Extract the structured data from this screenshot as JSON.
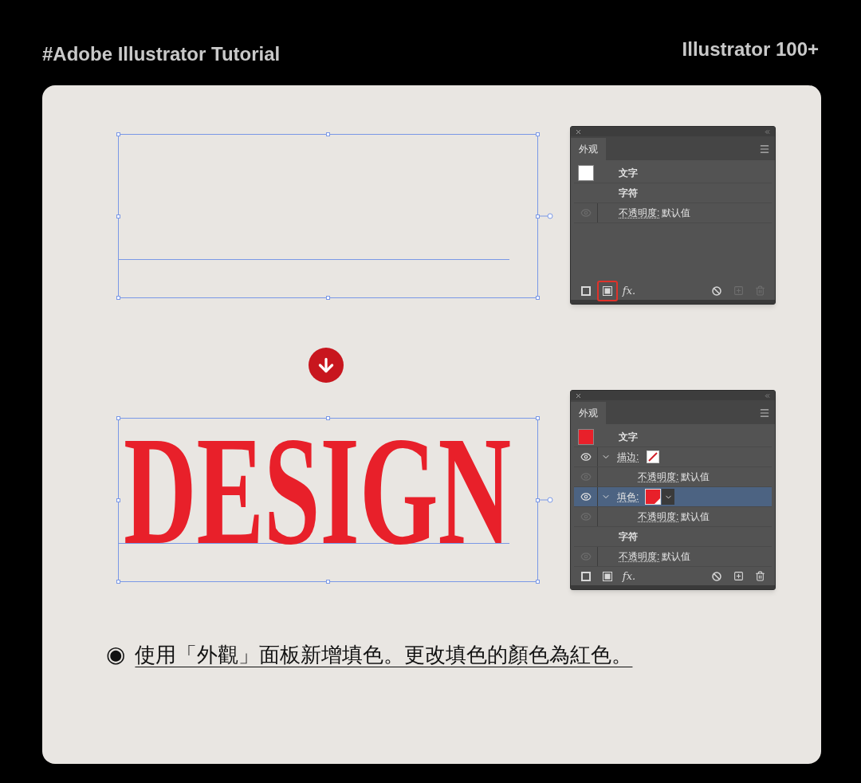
{
  "header": {
    "hashtag": "#Adobe Illustrator Tutorial",
    "series": "Illustrator 100+"
  },
  "steps": [
    {
      "panel": {
        "tab": "外观",
        "rows": [
          {
            "kind": "object",
            "label": "文字",
            "color": "#ffffff",
            "selected": false
          },
          {
            "kind": "group",
            "label": "字符",
            "selected": false
          },
          {
            "kind": "opacity",
            "label": "不透明度:",
            "value": "默认值",
            "eye_on": false,
            "selected": false
          }
        ],
        "footer": [
          {
            "kind": "new-stroke",
            "highlighted": false,
            "disabled": false
          },
          {
            "kind": "new-fill",
            "highlighted": true,
            "disabled": false
          },
          {
            "kind": "fx",
            "label": "fx.",
            "highlighted": false,
            "disabled": false
          },
          {
            "kind": "clear",
            "highlighted": false,
            "disabled": false
          },
          {
            "kind": "duplicate",
            "highlighted": false,
            "disabled": true
          },
          {
            "kind": "delete",
            "highlighted": false,
            "disabled": true
          }
        ]
      }
    },
    {
      "artwork_text": "DESIGN",
      "panel": {
        "tab": "外观",
        "rows": [
          {
            "kind": "object",
            "label": "文字",
            "color": "#e8202a",
            "selected": false
          },
          {
            "kind": "stroke",
            "label": "描边:",
            "eye_on": true,
            "expanded": true,
            "selected": false,
            "children": [
              {
                "kind": "opacity",
                "label": "不透明度:",
                "value": "默认值",
                "eye_on": false,
                "selected": false
              }
            ]
          },
          {
            "kind": "fill",
            "label": "填色:",
            "color": "#e8202a",
            "eye_on": true,
            "expanded": true,
            "selected": true,
            "children": [
              {
                "kind": "opacity",
                "label": "不透明度:",
                "value": "默认值",
                "eye_on": false,
                "selected": false
              }
            ]
          },
          {
            "kind": "group",
            "label": "字符",
            "selected": false
          },
          {
            "kind": "opacity",
            "label": "不透明度:",
            "value": "默认值",
            "eye_on": false,
            "selected": false
          }
        ],
        "footer": [
          {
            "kind": "new-stroke",
            "highlighted": false,
            "disabled": false
          },
          {
            "kind": "new-fill",
            "highlighted": false,
            "disabled": false
          },
          {
            "kind": "fx",
            "label": "fx.",
            "highlighted": false,
            "disabled": false
          },
          {
            "kind": "clear",
            "highlighted": false,
            "disabled": false
          },
          {
            "kind": "duplicate",
            "highlighted": false,
            "disabled": false
          },
          {
            "kind": "delete",
            "highlighted": false,
            "disabled": false
          }
        ]
      }
    }
  ],
  "caption": {
    "bullet": "◉",
    "text": "使用「外觀」面板新增填色。更改填色的顏色為紅色。"
  }
}
